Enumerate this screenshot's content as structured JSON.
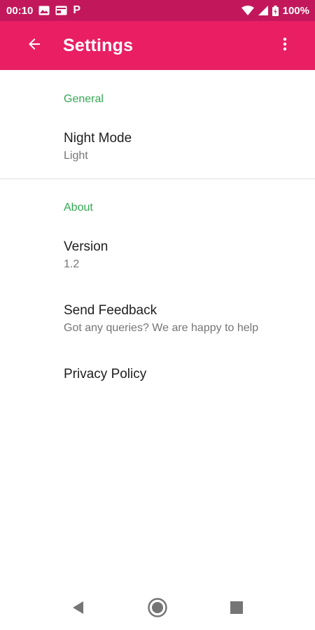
{
  "status_bar": {
    "time": "00:10",
    "battery": "100%",
    "icons": [
      "image-icon",
      "card-icon",
      "p-app-icon",
      "wifi-icon",
      "signal-icon",
      "battery-icon"
    ],
    "p_glyph": "P"
  },
  "app_bar": {
    "title": "Settings",
    "back_icon": "arrow-back-icon",
    "overflow_icon": "more-vert-icon"
  },
  "sections": [
    {
      "header": "General",
      "items": [
        {
          "title": "Night Mode",
          "summary": "Light"
        }
      ]
    },
    {
      "header": "About",
      "items": [
        {
          "title": "Version",
          "summary": "1.2"
        },
        {
          "title": "Send Feedback",
          "summary": "Got any queries? We are happy to help"
        },
        {
          "title": "Privacy Policy",
          "summary": ""
        }
      ]
    }
  ],
  "colors": {
    "status_bar": "#c2185b",
    "app_bar": "#e91e63",
    "section_header": "#34a853",
    "title_text": "#202020",
    "summary_text": "#757575"
  },
  "nav_bar": {
    "icons": [
      "nav-back-icon",
      "nav-home-icon",
      "nav-recents-icon"
    ]
  }
}
